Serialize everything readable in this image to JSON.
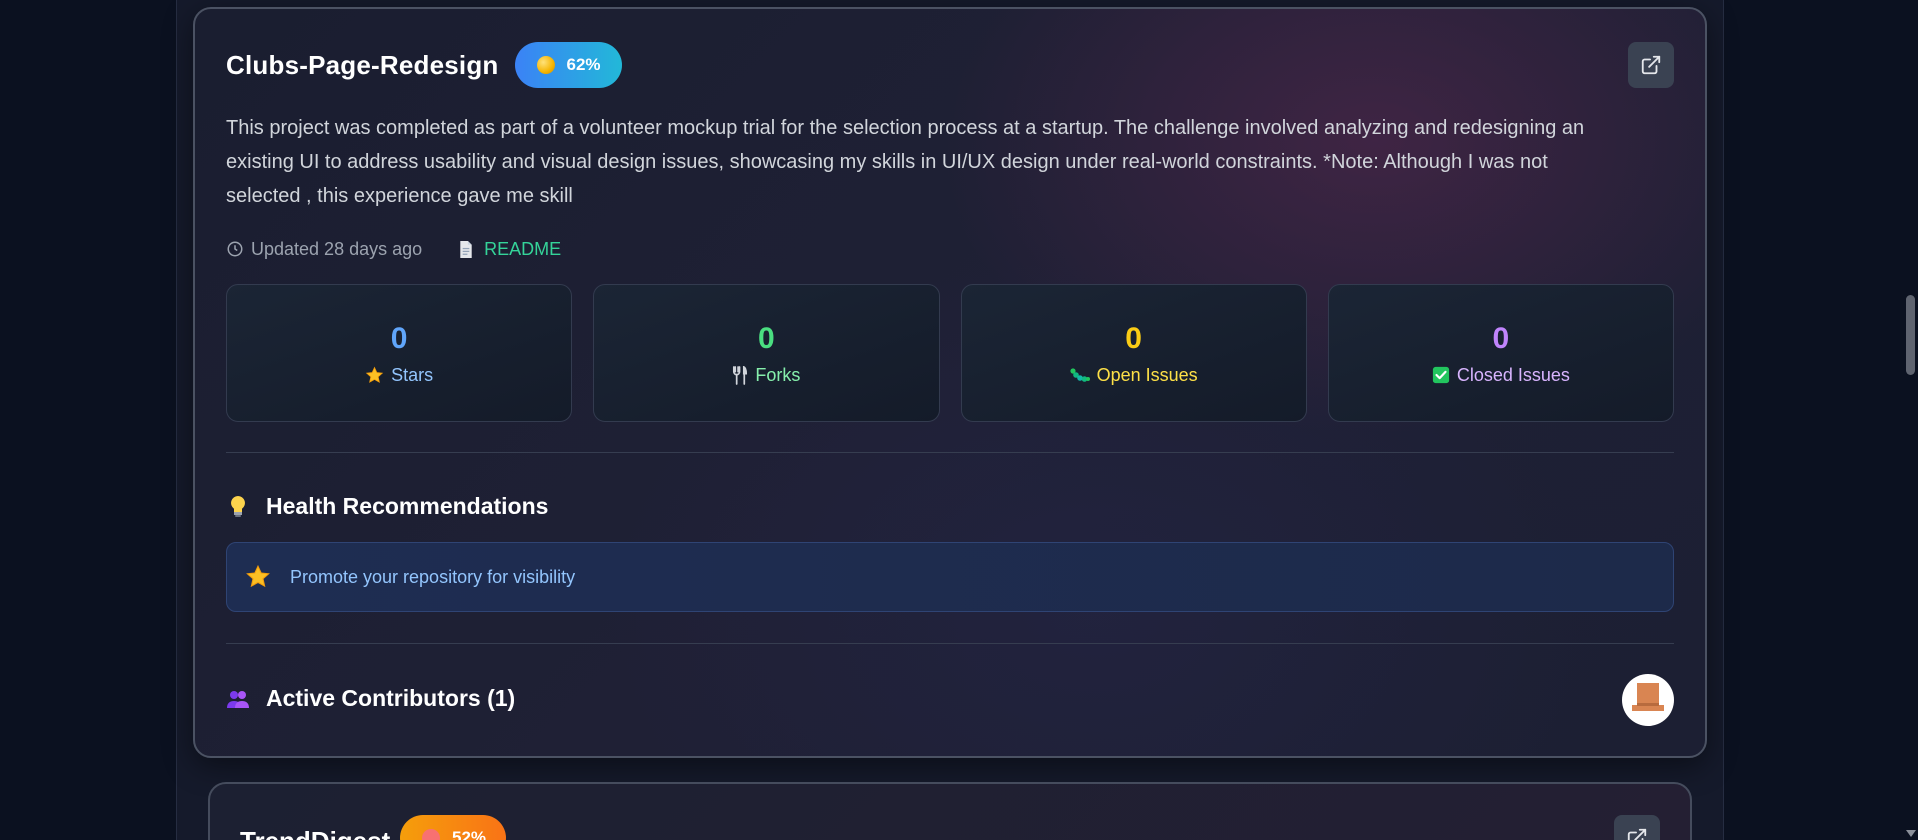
{
  "repo": {
    "name": "Clubs-Page-Redesign",
    "health": "62%",
    "description": "This project was completed as part of a volunteer mockup trial for the selection process at a startup. The challenge involved analyzing and redesigning an existing UI to address usability and visual design issues, showcasing my skills in UI/UX design under real-world constraints. *Note: Although I was not selected , this experience gave me skill",
    "updated": "Updated 28 days ago",
    "readme": "README",
    "stats": [
      {
        "value": "0",
        "label": "Stars",
        "color": "#60a5fa",
        "icon": "star-icon"
      },
      {
        "value": "0",
        "label": "Forks",
        "color": "#4ade80",
        "icon": "fork-knife-icon"
      },
      {
        "value": "0",
        "label": "Open Issues",
        "color": "#facc15",
        "icon": "caterpillar-icon"
      },
      {
        "value": "0",
        "label": "Closed Issues",
        "color": "#c084fc",
        "icon": "check-box-icon"
      }
    ],
    "recommendations_heading": "Health Recommendations",
    "recommendations": [
      "Promote your repository for visibility"
    ],
    "contributors_heading": "Active Contributors (1)"
  },
  "next_repo": {
    "name": "TrendDigest",
    "health": "52%"
  }
}
